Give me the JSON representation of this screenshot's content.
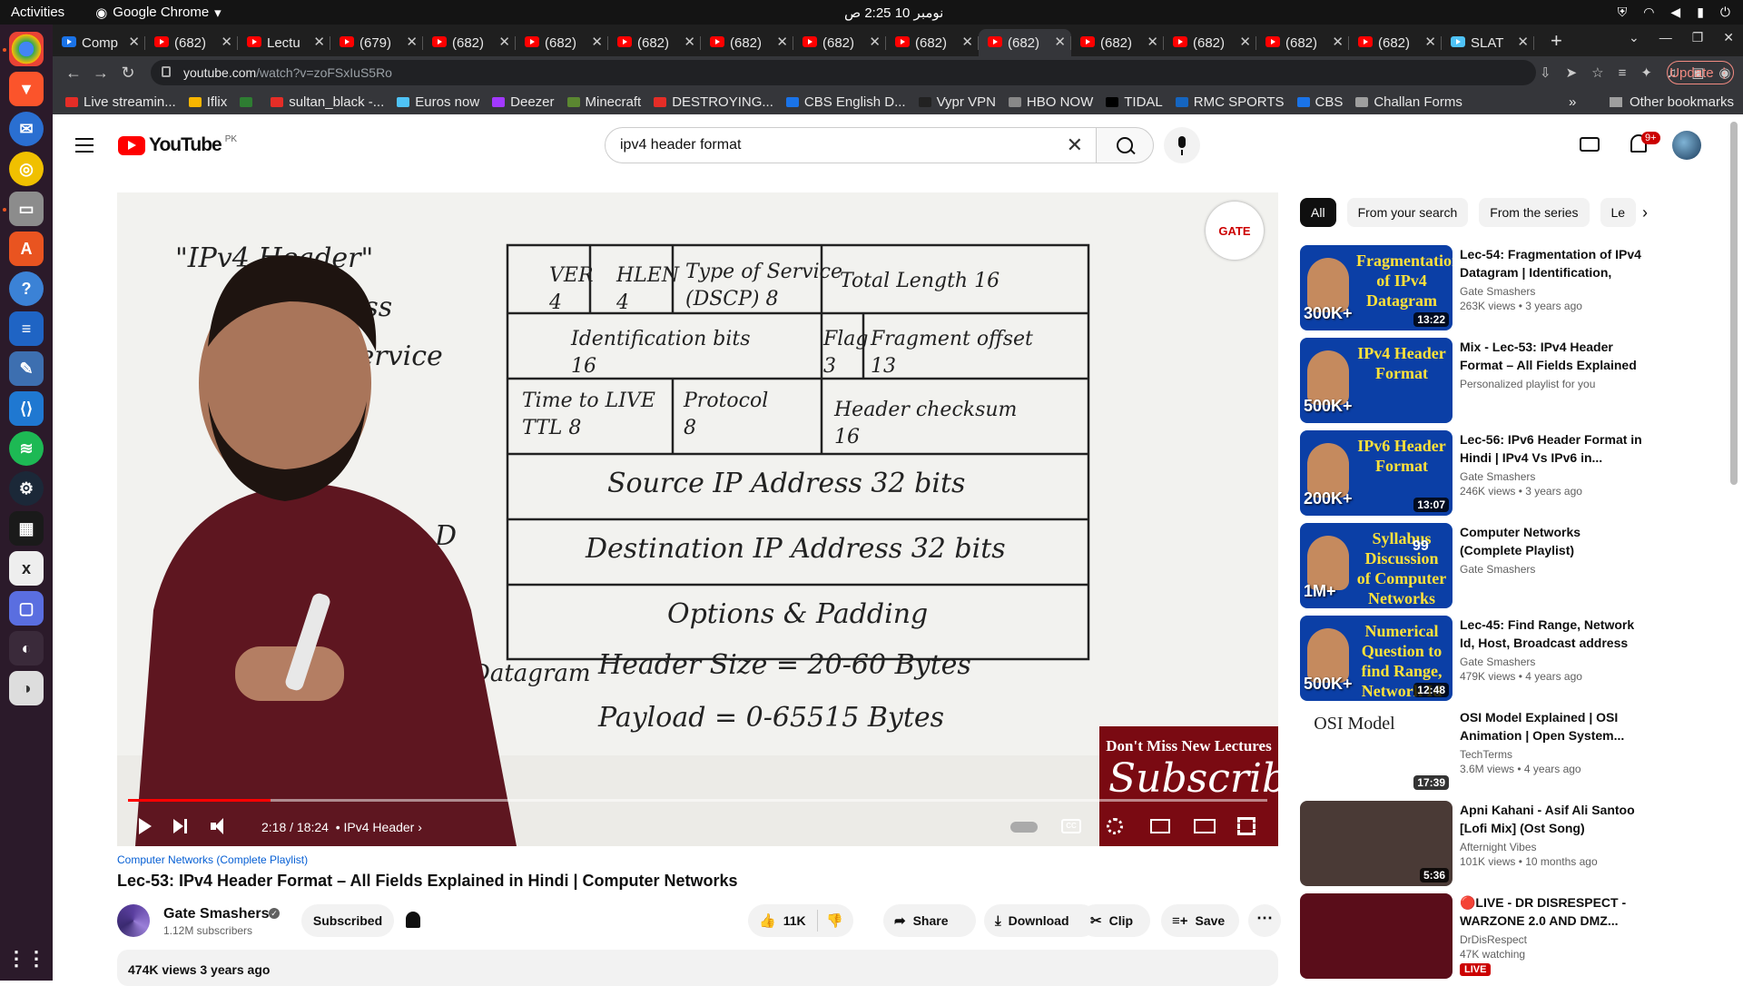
{
  "os": {
    "activities": "Activities",
    "app_name": "Google Chrome",
    "clock": "نومبر 10  2:25 ص"
  },
  "browser": {
    "tabs": [
      {
        "label": "Comp",
        "active": false
      },
      {
        "label": "(682)",
        "active": false
      },
      {
        "label": "Lectu",
        "active": false
      },
      {
        "label": "(679)",
        "active": false
      },
      {
        "label": "(682)",
        "active": false
      },
      {
        "label": "(682)",
        "active": false
      },
      {
        "label": "(682)",
        "active": false
      },
      {
        "label": "(682)",
        "active": false
      },
      {
        "label": "(682)",
        "active": false
      },
      {
        "label": "(682)",
        "active": false
      },
      {
        "label": "(682)",
        "active": true
      },
      {
        "label": "(682)",
        "active": false
      },
      {
        "label": "(682)",
        "active": false
      },
      {
        "label": "(682)",
        "active": false
      },
      {
        "label": "(682)",
        "active": false
      },
      {
        "label": "SLAT",
        "active": false
      }
    ],
    "url_host": "youtube.com",
    "url_path": "/watch?v=zoFSxIuS5Ro",
    "update_label": "Update",
    "bookmarks": [
      {
        "label": "Live streamin...",
        "color": "#e52d27"
      },
      {
        "label": "Iflix",
        "color": "#f7b500"
      },
      {
        "label": "",
        "color": "#2e7d32"
      },
      {
        "label": "sultan_black -...",
        "color": "#e52d27"
      },
      {
        "label": "Euros now",
        "color": "#4fc3f7"
      },
      {
        "label": "Deezer",
        "color": "#a238ff"
      },
      {
        "label": "Minecraft",
        "color": "#5b8731"
      },
      {
        "label": "DESTROYING...",
        "color": "#e52d27"
      },
      {
        "label": "CBS English D...",
        "color": "#1a73e8"
      },
      {
        "label": "Vypr VPN",
        "color": "#222"
      },
      {
        "label": "HBO NOW",
        "color": "#888"
      },
      {
        "label": "TIDAL",
        "color": "#000"
      },
      {
        "label": "RMC SPORTS",
        "color": "#1565c0"
      },
      {
        "label": "CBS",
        "color": "#1a73e8"
      },
      {
        "label": "Challan Forms",
        "color": "#9e9e9e"
      }
    ],
    "other_bookmarks": "Other bookmarks"
  },
  "youtube": {
    "country": "PK",
    "search_value": "ipv4 header format",
    "notif_badge": "9+",
    "brand_color": "#ff0000"
  },
  "player": {
    "current_time": "2:18 / 18:24",
    "chapter": "• IPv4 Header",
    "progress_fraction": 0.1251,
    "watermark": "GATE",
    "ad_line1": "Don't Miss New Lectures",
    "ad_line2": "Subscribe"
  },
  "whiteboard": {
    "heading": "\"IPv4 Header\"",
    "cells": [
      {
        "text": "VER\n4"
      },
      {
        "text": "HLEN\n4"
      },
      {
        "text": "Type of Service\n(DSCP) 8"
      },
      {
        "text": "Total Length   16"
      },
      {
        "text": "Identification bits\n16"
      },
      {
        "text": "Flag\n3"
      },
      {
        "text": "Fragment offset\n13"
      },
      {
        "text": "Time to LIVE\nTTL  8"
      },
      {
        "text": "Protocol\n8"
      },
      {
        "text": "Header checksum\n16"
      },
      {
        "text": "Source IP Address   32 bits"
      },
      {
        "text": "Destination IP Address   32 bits"
      },
      {
        "text": "Options & Padding"
      }
    ],
    "note1": "Datagram",
    "note2": "Header Size = 20-60 Bytes",
    "note3": "Payload = 0-65515 Bytes",
    "side1": "less",
    "side2": "Service",
    "side3": "D"
  },
  "video": {
    "playlist_link": "Computer Networks (Complete Playlist)",
    "title": "Lec-53: IPv4 Header Format – All Fields Explained in Hindi | Computer Networks",
    "channel": "Gate Smashers",
    "subscribers": "1.12M subscribers",
    "subscribe_label": "Subscribed",
    "likes": "11K",
    "share": "Share",
    "download": "Download",
    "clip": "Clip",
    "save": "Save",
    "views_date": "474K views  3 years ago"
  },
  "sidebar": {
    "chips": [
      "All",
      "From your search",
      "From the series",
      "Le"
    ],
    "items": [
      {
        "title": "Lec-54: Fragmentation of IPv4 Datagram | Identification, Flag...",
        "channel": "Gate Smashers",
        "meta": "263K views • 3 years ago",
        "duration": "13:22",
        "thumb_text": "Fragmentation of IPv4 Datagram",
        "thumb_views": "300K+",
        "bg": "#0b3fa6"
      },
      {
        "title": "Mix - Lec-53: IPv4 Header Format – All Fields Explained i...",
        "channel": "Personalized playlist for you",
        "meta": "",
        "duration": "",
        "thumb_text": "IPv4 Header Format",
        "thumb_views": "500K+",
        "bg": "#0b3fa6"
      },
      {
        "title": "Lec-56: IPv6 Header Format in Hindi | IPv4 Vs IPv6 in...",
        "channel": "Gate Smashers",
        "meta": "246K views • 3 years ago",
        "duration": "13:07",
        "thumb_text": "IPv6 Header Format",
        "thumb_views": "200K+",
        "bg": "#0b3fa6"
      },
      {
        "title": "Computer Networks (Complete Playlist)",
        "channel": "Gate Smashers",
        "meta": "",
        "duration": "99",
        "thumb_text": "Syllabus Discussion of Computer Networks",
        "thumb_views": "1M+",
        "bg": "#0b3fa6"
      },
      {
        "title": "Lec-45: Find Range, Network Id, Host, Broadcast address with...",
        "channel": "Gate Smashers",
        "meta": "479K views • 4 years ago",
        "duration": "12:48",
        "thumb_text": "Numerical Question to find Range, Network Id",
        "thumb_views": "500K+",
        "bg": "#0b3fa6"
      },
      {
        "title": "OSI Model Explained | OSI Animation | Open System...",
        "channel": "TechTerms",
        "meta": "3.6M views • 4 years ago",
        "duration": "17:39",
        "thumb_text": "OSI Model",
        "thumb_views": "",
        "bg": "#ffffff"
      },
      {
        "title": "Apni Kahani - Asif Ali Santoo [Lofi Mix] (Ost Song) Afternigh...",
        "channel": "Afternight Vibes",
        "meta": "101K views • 10 months ago",
        "duration": "5:36",
        "thumb_text": "",
        "thumb_views": "",
        "bg": "#4a3a36"
      },
      {
        "title": "🔴LIVE - DR DISRESPECT - WARZONE 2.0 AND DMZ...",
        "channel": "DrDisRespect",
        "meta": "47K watching",
        "duration": "",
        "thumb_text": "",
        "thumb_views": "",
        "bg": "#5a0d1a",
        "live": "LIVE"
      }
    ]
  }
}
